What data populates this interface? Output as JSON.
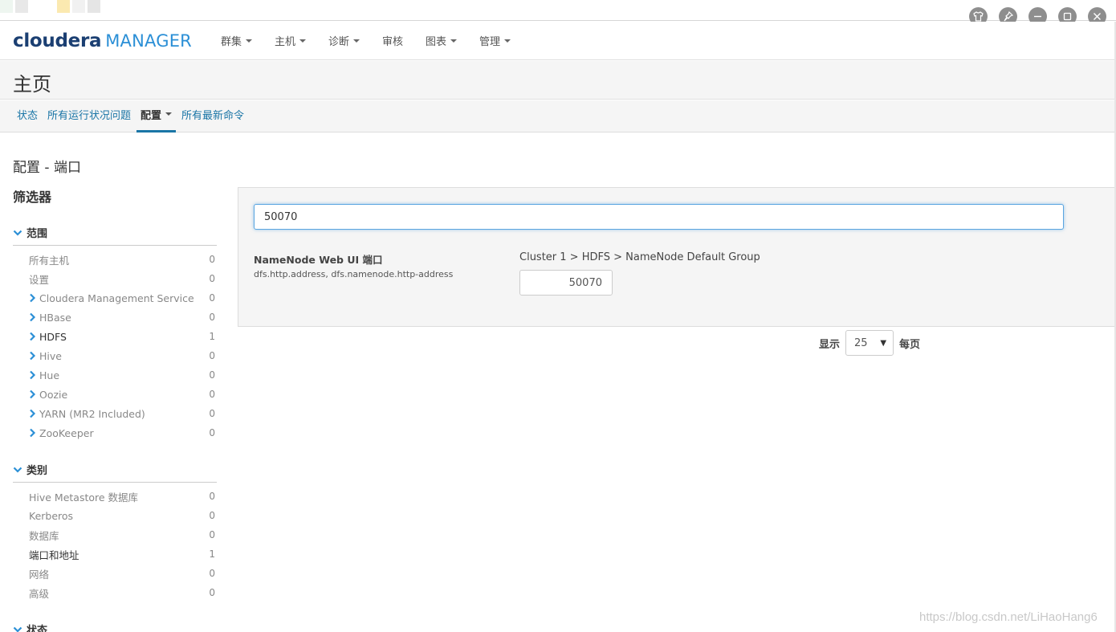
{
  "window": {
    "controls": [
      "shirt-icon",
      "pin-icon",
      "minimize-icon",
      "maximize-icon",
      "close-icon"
    ]
  },
  "brand": {
    "part1": "cloudera",
    "part2": "MANAGER"
  },
  "topnav": {
    "items": [
      {
        "label": "群集",
        "dropdown": true
      },
      {
        "label": "主机",
        "dropdown": true
      },
      {
        "label": "诊断",
        "dropdown": true
      },
      {
        "label": "审核",
        "dropdown": false
      },
      {
        "label": "图表",
        "dropdown": true
      },
      {
        "label": "管理",
        "dropdown": true
      }
    ]
  },
  "page": {
    "title": "主页"
  },
  "subnav": {
    "tabs": [
      {
        "label": "状态",
        "active": false
      },
      {
        "label": "所有运行状况问题",
        "active": false
      },
      {
        "label": "配置",
        "active": true,
        "dropdown": true
      },
      {
        "label": "所有最新命令",
        "active": false
      }
    ]
  },
  "section": {
    "title": "配置 - 端口"
  },
  "filters": {
    "title": "筛选器",
    "groups": [
      {
        "title": "范围",
        "items": [
          {
            "label": "所有主机",
            "count": "0",
            "expandable": false
          },
          {
            "label": "设置",
            "count": "0",
            "expandable": false
          },
          {
            "label": "Cloudera Management Service",
            "count": "0",
            "expandable": true
          },
          {
            "label": "HBase",
            "count": "0",
            "expandable": true
          },
          {
            "label": "HDFS",
            "count": "1",
            "expandable": true,
            "strong": true
          },
          {
            "label": "Hive",
            "count": "0",
            "expandable": true
          },
          {
            "label": "Hue",
            "count": "0",
            "expandable": true
          },
          {
            "label": "Oozie",
            "count": "0",
            "expandable": true
          },
          {
            "label": "YARN (MR2 Included)",
            "count": "0",
            "expandable": true
          },
          {
            "label": "ZooKeeper",
            "count": "0",
            "expandable": true
          }
        ]
      },
      {
        "title": "类别",
        "items": [
          {
            "label": "Hive Metastore 数据库",
            "count": "0"
          },
          {
            "label": "Kerberos",
            "count": "0"
          },
          {
            "label": "数据库",
            "count": "0"
          },
          {
            "label": "端口和地址",
            "count": "1",
            "strong": true
          },
          {
            "label": "网络",
            "count": "0"
          },
          {
            "label": "高级",
            "count": "0"
          }
        ]
      }
    ],
    "next_group_title": "状态"
  },
  "search": {
    "value": "50070"
  },
  "result": {
    "name": "NameNode Web UI 端口",
    "keys": "dfs.http.address, dfs.namenode.http-address",
    "scope": "Cluster 1 > HDFS > NameNode Default Group",
    "value": "50070"
  },
  "pager": {
    "show_label": "显示",
    "per_page": "25",
    "per_page_label": "每页"
  },
  "watermark": "https://blog.csdn.net/LiHaoHang6",
  "colors": {
    "link": "#1a75a6",
    "brand_dark": "#1b3f72",
    "brand_light": "#2b8fd6",
    "chevron": "#2b8fd6"
  }
}
